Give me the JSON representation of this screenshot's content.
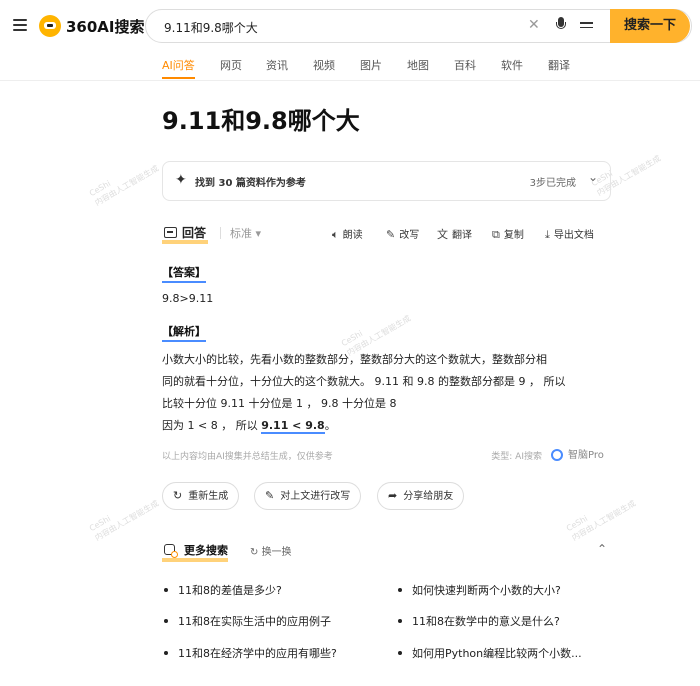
{
  "header": {
    "logo_text": "360AI搜索",
    "search_value": "9.11和9.8哪个大",
    "search_button": "搜索一下",
    "icons": [
      "menu-icon",
      "clear-icon",
      "microphone-icon",
      "settings-sliders-icon"
    ]
  },
  "tabs": [
    "AI问答",
    "网页",
    "资讯",
    "视频",
    "图片",
    "地图",
    "百科",
    "软件",
    "翻译"
  ],
  "active_tab": "AI问答",
  "colors": {
    "accent": "#ff8a00",
    "button": "#ffb22c",
    "link_blue": "#4a8cff"
  },
  "title": "9.11和9.8哪个大",
  "reference": {
    "text": "找到 30 篇资料作为参考",
    "status": "3步已完成"
  },
  "answer_bar": {
    "tab_label": "回答",
    "mode": "标准",
    "actions": [
      "朗读",
      "改写",
      "翻译",
      "复制",
      "导出文档"
    ]
  },
  "answer": {
    "answer_label": "【答案】",
    "answer_value": "9.8>9.11",
    "analysis_label": "【解析】",
    "lines": [
      "小数大小的比较，先看小数的整数部分，整数部分大的这个数就大，整数部分相",
      "同的就看十分位，十分位大的这个数就大。 9.11 和 9.8 的整数部分都是 9 ， 所以",
      "比较十分位 9.11 十分位是 1 ， 9.8 十分位是 8"
    ],
    "last_prefix": "因为 1 < 8 ， 所以 ",
    "last_emph": "9.11 < 9.8",
    "last_suffix": "。"
  },
  "footer_note": {
    "disclaimer": "以上内容均由AI搜集并总结生成，仅供参考",
    "type_label": "类型:  AI搜索",
    "brand": "智脑Pro"
  },
  "pills": [
    "重新生成",
    "对上文进行改写",
    "分享给朋友"
  ],
  "more": {
    "title": "更多搜索",
    "refresh": "换一换",
    "items": [
      "11和8的差值是多少?",
      "如何快速判断两个小数的大小?",
      "11和8在实际生活中的应用例子",
      "11和8在数学中的意义是什么?",
      "11和8在经济学中的应用有哪些?",
      "如何用Python编程比较两个小数..."
    ]
  },
  "watermark": [
    "CeShi",
    "内容由人工智能生成"
  ]
}
